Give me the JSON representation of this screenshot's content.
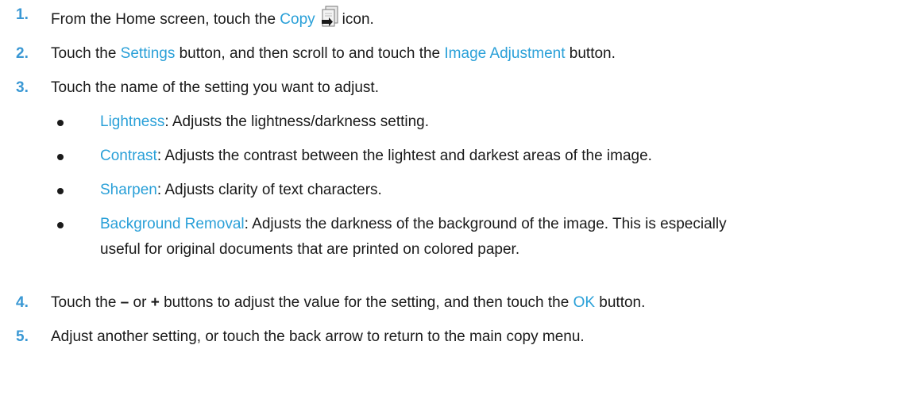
{
  "steps": [
    {
      "num": "1.",
      "pre": "From the Home screen, touch the ",
      "hl1": "Copy",
      "post": "icon."
    },
    {
      "num": "2.",
      "pre": "Touch the ",
      "hl1": "Settings",
      "mid": " button, and then scroll to and touch the ",
      "hl2": "Image Adjustment",
      "post": " button."
    },
    {
      "num": "3.",
      "text": "Touch the name of the setting you want to adjust."
    },
    {
      "num": "4.",
      "pre": "Touch the ",
      "minus": "–",
      "or": " or ",
      "plus": "+",
      "mid": " buttons to adjust the value for the setting, and then touch the ",
      "hl1": "OK",
      "post": " button."
    },
    {
      "num": "5.",
      "text": "Adjust another setting, or touch the back arrow to return to the main copy menu."
    }
  ],
  "bullets": [
    {
      "term": "Lightness",
      "desc": ": Adjusts the lightness/darkness setting."
    },
    {
      "term": "Contrast",
      "desc": ": Adjusts the contrast between the lightest and darkest areas of the image."
    },
    {
      "term": "Sharpen",
      "desc": ": Adjusts clarity of text characters."
    },
    {
      "term": "Background Removal",
      "desc": ": Adjusts the darkness of the background of the image. This is especially",
      "desc2": "useful for original documents that are printed on colored paper."
    }
  ],
  "icons": {
    "copy": "copy-icon"
  },
  "colors": {
    "accent": "#2aa0d8",
    "number": "#3a98d4",
    "text": "#1a1a1a"
  }
}
